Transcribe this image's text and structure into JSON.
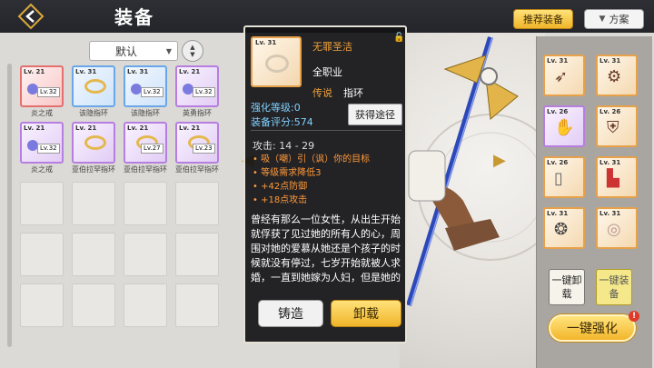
{
  "header": {
    "title": "装备",
    "recommend_button": "推荐装备",
    "plan_button": "方案"
  },
  "inventory": {
    "sort_value": "默认",
    "items": [
      {
        "lv": "Lv. 21",
        "sub_lv": "Lv.32",
        "name": "炎之戒"
      },
      {
        "lv": "Lv. 31",
        "sub_lv": "",
        "name": "该隐指环"
      },
      {
        "lv": "Lv. 31",
        "sub_lv": "Lv.32",
        "name": "该隐指环"
      },
      {
        "lv": "Lv. 21",
        "sub_lv": "Lv.32",
        "name": "英勇指环"
      },
      {
        "lv": "Lv. 21",
        "sub_lv": "Lv.32",
        "name": "炎之戒"
      },
      {
        "lv": "Lv. 21",
        "sub_lv": "",
        "name": "亚伯拉罕指环"
      },
      {
        "lv": "Lv. 21",
        "sub_lv": "Lv.27",
        "name": "亚伯拉罕指环"
      },
      {
        "lv": "Lv. 21",
        "sub_lv": "Lv.23",
        "name": "亚伯拉罕指环"
      }
    ]
  },
  "tooltip": {
    "level": "Lv. 31",
    "name": "无罪圣洁",
    "class": "全职业",
    "quality": "传说",
    "type": "指环",
    "enhance": "强化等级:0",
    "score": "装备评分:574",
    "source_button": "获得途径",
    "attack": "攻击: 14 - 29",
    "props": [
      "• 吸（嘲）引（讽）你的目标",
      "• 等级需求降低3",
      "• +42点防御",
      "• +18点攻击"
    ],
    "description": "曾经有那么一位女性，从出生开始就俘获了见过她的所有人的心，周围对她的爱慕从她还是个孩子的时候就没有停过，七岁开始就被人求婚，一直到她嫁为人妇，但是她的爱慕者",
    "forge_button": "铸造",
    "unload_button": "卸载"
  },
  "equipped": {
    "slots": [
      {
        "lv": "Lv. 31",
        "icon": "dark-weapon-icon",
        "color": "orange"
      },
      {
        "lv": "Lv. 31",
        "icon": "gear-ornament-icon",
        "color": "orange"
      },
      {
        "lv": "Lv. 26",
        "icon": "gloves-icon",
        "color": "purple"
      },
      {
        "lv": "Lv. 26",
        "icon": "armor-icon",
        "color": "orange"
      },
      {
        "lv": "Lv. 26",
        "icon": "greaves-icon",
        "color": "orange"
      },
      {
        "lv": "Lv. 31",
        "icon": "boots-icon",
        "color": "orange"
      },
      {
        "lv": "Lv. 31",
        "icon": "amulet-icon",
        "color": "orange"
      },
      {
        "lv": "Lv. 31",
        "icon": "ring-icon",
        "color": "orange"
      }
    ],
    "unequip_all": "一键卸载",
    "equip_all": "一键装备",
    "enhance_all": "一键强化",
    "badge": "!"
  },
  "colors": {
    "accent": "#f0b52a",
    "legend_text": "#f0a23a",
    "stat_blue": "#7fd1ff",
    "prop_orange": "#ff9a3a"
  }
}
